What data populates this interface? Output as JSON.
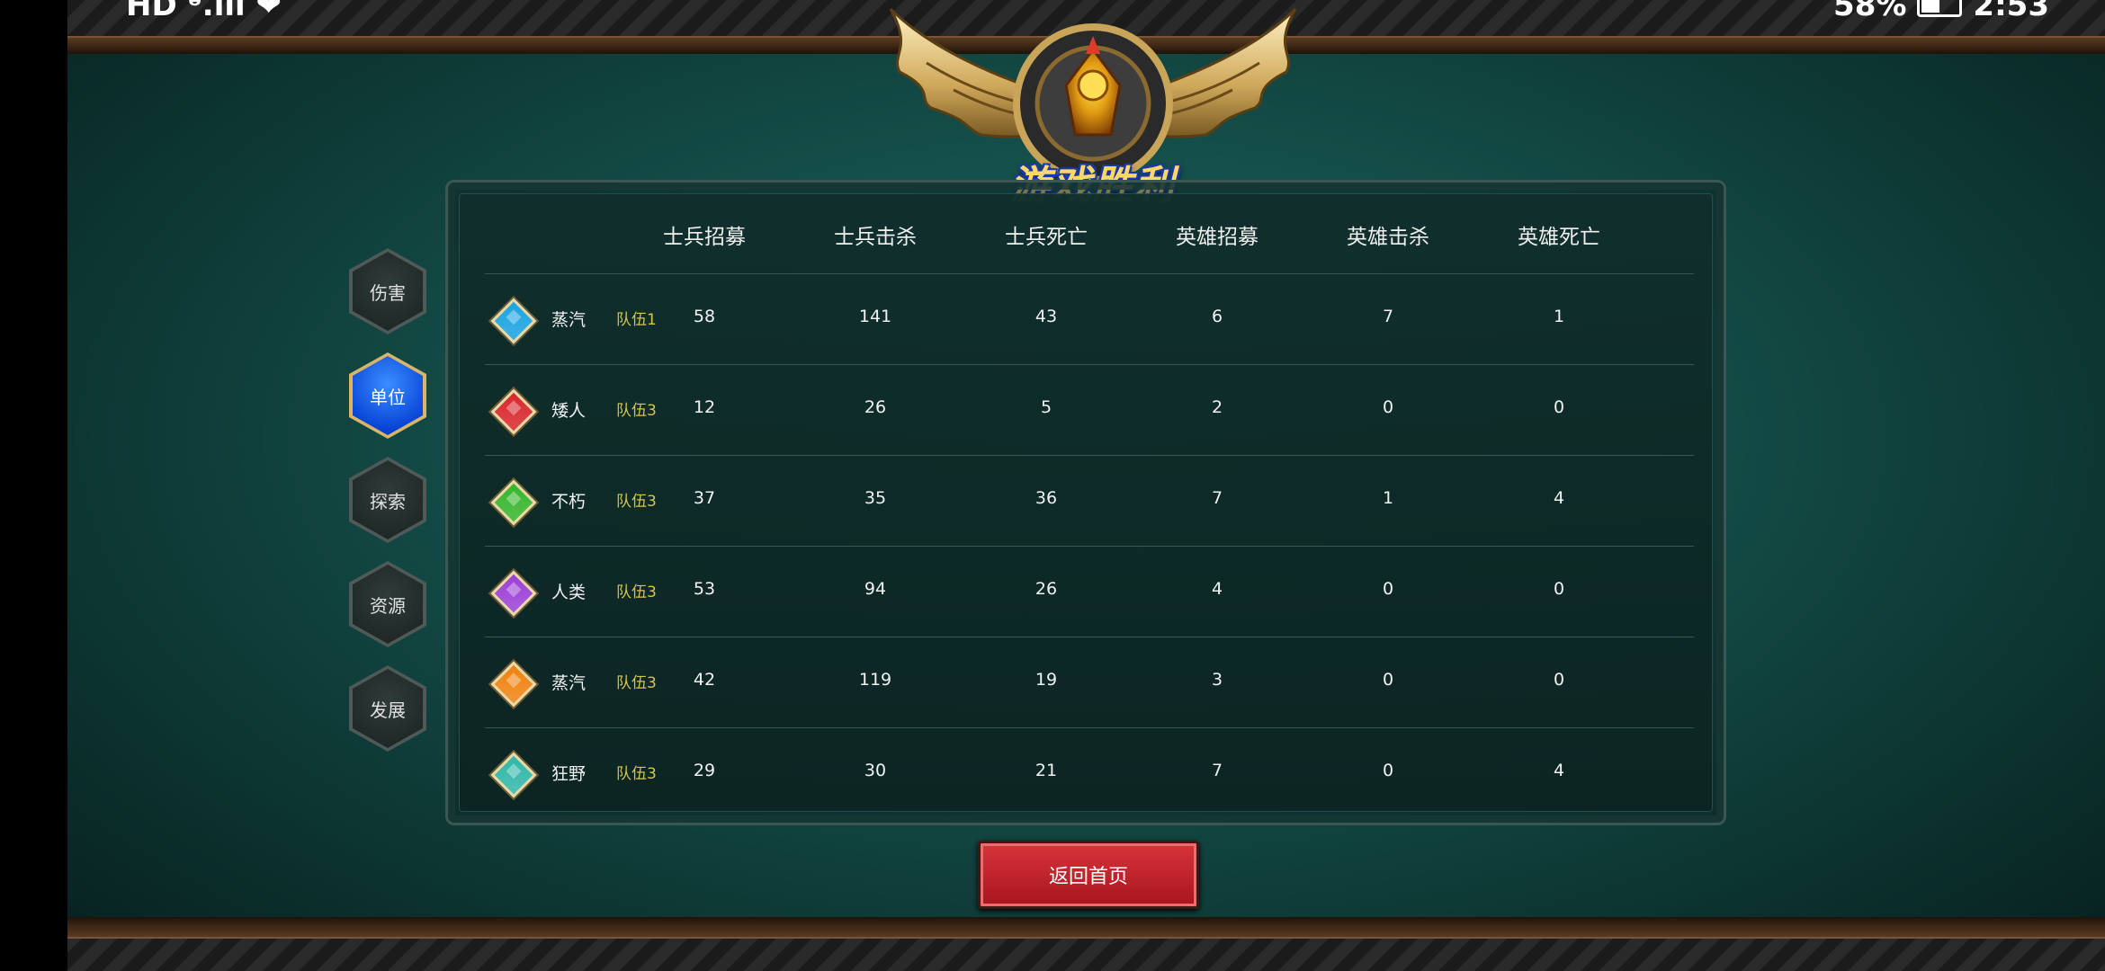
{
  "status_bar": {
    "left": "HD ᵊ.ıll ❤",
    "battery": "58%",
    "time": "2:53"
  },
  "title": "游戏胜利",
  "side_menu": [
    {
      "label": "伤害",
      "active": false
    },
    {
      "label": "单位",
      "active": true
    },
    {
      "label": "探索",
      "active": false
    },
    {
      "label": "资源",
      "active": false
    },
    {
      "label": "发展",
      "active": false
    }
  ],
  "table": {
    "headers": [
      "士兵招募",
      "士兵击杀",
      "士兵死亡",
      "英雄招募",
      "英雄击杀",
      "英雄死亡"
    ],
    "rows": [
      {
        "gem_color": "#1aa3e0",
        "race": "蒸汽",
        "team": "队伍1",
        "values": [
          "58",
          "141",
          "43",
          "6",
          "7",
          "1"
        ]
      },
      {
        "gem_color": "#d8262c",
        "race": "矮人",
        "team": "队伍3",
        "values": [
          "12",
          "26",
          "5",
          "2",
          "0",
          "0"
        ]
      },
      {
        "gem_color": "#35b52a",
        "race": "不朽",
        "team": "队伍3",
        "values": [
          "37",
          "35",
          "36",
          "7",
          "1",
          "4"
        ]
      },
      {
        "gem_color": "#9b3fd6",
        "race": "人类",
        "team": "队伍3",
        "values": [
          "53",
          "94",
          "26",
          "4",
          "0",
          "0"
        ]
      },
      {
        "gem_color": "#f0820f",
        "race": "蒸汽",
        "team": "队伍3",
        "values": [
          "42",
          "119",
          "19",
          "3",
          "0",
          "0"
        ]
      },
      {
        "gem_color": "#2fb6a8",
        "race": "狂野",
        "team": "队伍3",
        "values": [
          "29",
          "30",
          "21",
          "7",
          "0",
          "4"
        ]
      }
    ]
  },
  "buttons": {
    "home": "返回首页"
  }
}
